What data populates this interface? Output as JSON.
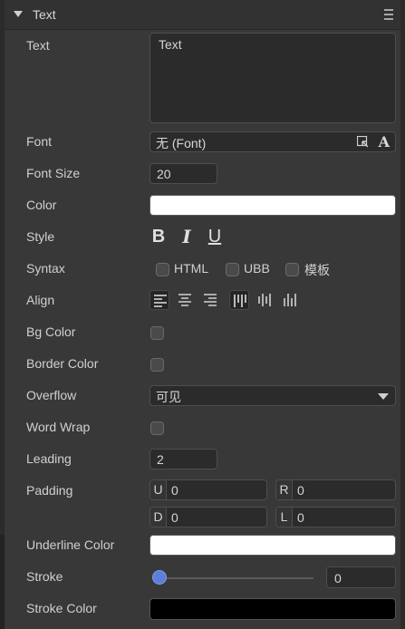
{
  "header": {
    "title": "Text",
    "menu_icon": "menu-icon"
  },
  "rows": {
    "text": {
      "label": "Text",
      "value": "Text"
    },
    "font": {
      "label": "Font",
      "value": "无 (Font)"
    },
    "font_size": {
      "label": "Font Size",
      "value": "20"
    },
    "color": {
      "label": "Color",
      "value": "#ffffff"
    },
    "style": {
      "label": "Style",
      "bold": "B",
      "italic": "I",
      "underline": "U"
    },
    "syntax": {
      "label": "Syntax",
      "options": [
        "HTML",
        "UBB",
        "模板"
      ]
    },
    "align": {
      "label": "Align",
      "horizontal_selected": "left",
      "vertical_selected": "top"
    },
    "bg_color": {
      "label": "Bg Color"
    },
    "border_color": {
      "label": "Border Color"
    },
    "overflow": {
      "label": "Overflow",
      "value": "可见"
    },
    "word_wrap": {
      "label": "Word Wrap"
    },
    "leading": {
      "label": "Leading",
      "value": "2"
    },
    "padding": {
      "label": "Padding",
      "up": {
        "key": "U",
        "value": "0"
      },
      "right": {
        "key": "R",
        "value": "0"
      },
      "down": {
        "key": "D",
        "value": "0"
      },
      "left": {
        "key": "L",
        "value": "0"
      }
    },
    "underline_color": {
      "label": "Underline Color",
      "value": "#ffffff"
    },
    "stroke": {
      "label": "Stroke",
      "value": "0",
      "slider_fraction": 0
    },
    "stroke_color": {
      "label": "Stroke Color",
      "value": "#000000"
    }
  },
  "colors": {
    "accent": "#5c7fd9",
    "panel": "#383838",
    "field": "#2b2b2b"
  }
}
